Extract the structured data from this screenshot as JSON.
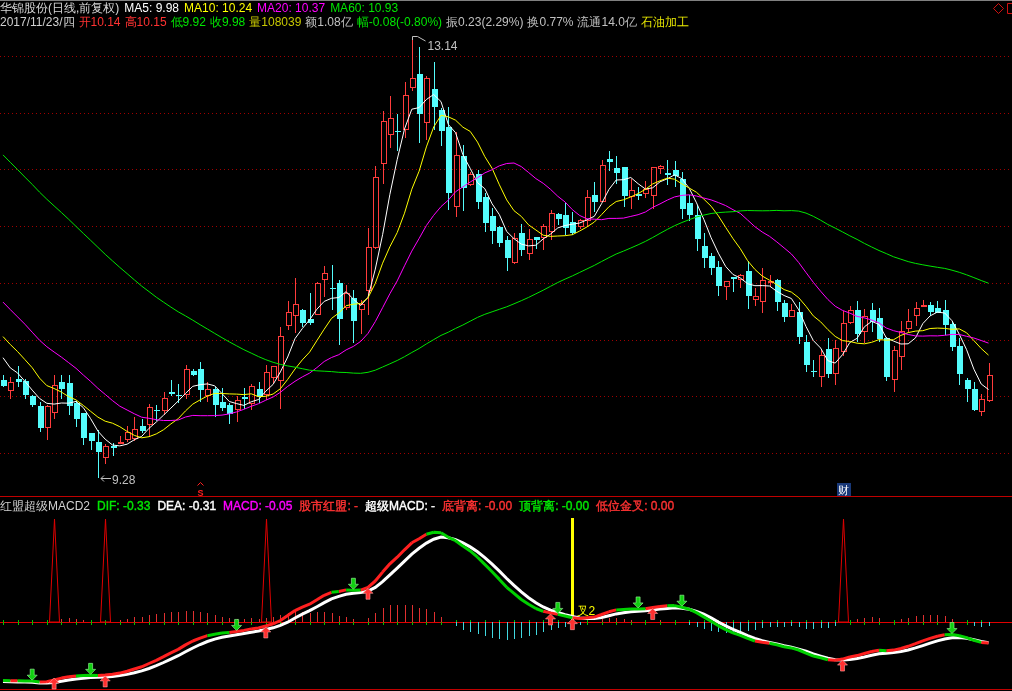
{
  "header": {
    "title": "华锦股份(日线,前复权)",
    "moving_averages": [
      {
        "text": "MA5: 9.98",
        "color": "#ffffff"
      },
      {
        "text": "MA10: 10.24",
        "color": "#ffff00"
      },
      {
        "text": "MA20: 10.37",
        "color": "#ff00ff"
      },
      {
        "text": "MA60: 10.93",
        "color": "#00e600"
      }
    ],
    "date": "2017/11/23/四",
    "quotes": [
      {
        "text": "开10.14",
        "color": "#ff3232"
      },
      {
        "text": "高10.15",
        "color": "#ff3232"
      },
      {
        "text": "低9.92",
        "color": "#00e600"
      },
      {
        "text": "收9.98",
        "color": "#00e600"
      },
      {
        "text": "量108039",
        "color": "#c8c800"
      },
      {
        "text": "额1.08亿",
        "color": "#c0c0c0"
      },
      {
        "text": "幅-0.08(-0.80%)",
        "color": "#00e600"
      },
      {
        "text": "振0.23(2.29%)",
        "color": "#c0c0c0"
      },
      {
        "text": "换0.77%",
        "color": "#c0c0c0"
      },
      {
        "text": "流通14.0亿",
        "color": "#c0c0c0"
      }
    ],
    "sector": "石油加工"
  },
  "price_chart": {
    "high_label": "13.14",
    "low_label": "9.28",
    "markers": [
      {
        "kind": "signal",
        "text": "S"
      },
      {
        "kind": "badge",
        "text": "财"
      }
    ]
  },
  "indicator": {
    "title": "红盟超级MACD2",
    "values": [
      {
        "text": "DIF: -0.33",
        "color": "#00e600"
      },
      {
        "text": "DEA: -0.31",
        "color": "#ffffff"
      },
      {
        "text": "MACD: -0.05",
        "color": "#ff00ff"
      },
      {
        "text": "股市红盟: -",
        "color": "#ff3232"
      },
      {
        "text": "超级MACD: -",
        "color": "#ffffff"
      },
      {
        "text": "底背离: -0.00",
        "color": "#ff3232"
      },
      {
        "text": "顶背离: -0.00",
        "color": "#00e600"
      },
      {
        "text": "低位金叉: 0.00",
        "color": "#ff3232"
      }
    ],
    "cross_label": "叉2"
  }
}
